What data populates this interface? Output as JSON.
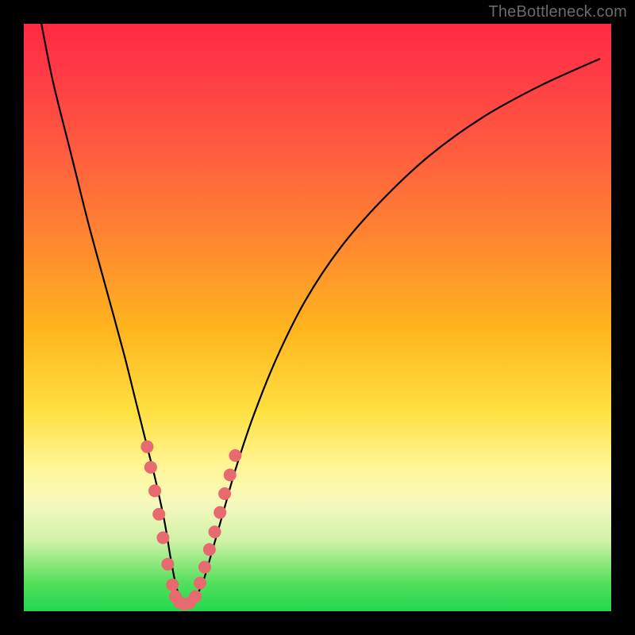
{
  "watermark": "TheBottleneck.com",
  "colors": {
    "frame": "#000000",
    "curve": "#000000",
    "marker": "#e76a6f",
    "gradient_stops": [
      "#ff2a41",
      "#ff3a45",
      "#ff5d3f",
      "#ff8a2f",
      "#ffb51e",
      "#ffe041",
      "#fff79b",
      "#f4f8bd",
      "#d0f2a7",
      "#56e05c",
      "#20d84e"
    ]
  },
  "chart_data": {
    "type": "line",
    "title": "",
    "xlabel": "",
    "ylabel": "",
    "xlim": [
      0,
      100
    ],
    "ylim": [
      0,
      100
    ],
    "grid": false,
    "legend": false,
    "series": [
      {
        "name": "bottleneck-curve",
        "x": [
          3,
          5,
          8,
          11,
          14,
          17,
          19,
          21,
          22.5,
          24,
          25,
          26,
          27,
          28,
          29,
          30.5,
          32,
          34,
          36,
          39,
          43,
          48,
          54,
          61,
          69,
          78,
          88,
          98
        ],
        "y": [
          100,
          90,
          78,
          66,
          55,
          44,
          36,
          28,
          22,
          15,
          9,
          4,
          1.5,
          1.2,
          2,
          5,
          10,
          17,
          24,
          33,
          43,
          53,
          62,
          70,
          77.5,
          84,
          89.5,
          94
        ]
      }
    ],
    "markers": {
      "name": "highlighted-points",
      "x": [
        21.0,
        21.6,
        22.3,
        23.0,
        23.7,
        24.5,
        25.3,
        25.8,
        26.5,
        27.3,
        28.2,
        29.2,
        30.0,
        30.8,
        31.6,
        32.5,
        33.4,
        34.2,
        35.1,
        36.0
      ],
      "y": [
        28.0,
        24.5,
        20.5,
        16.5,
        12.5,
        8.0,
        4.5,
        2.5,
        1.5,
        1.2,
        1.4,
        2.5,
        4.8,
        7.5,
        10.5,
        13.5,
        16.8,
        20.0,
        23.2,
        26.5
      ]
    }
  }
}
